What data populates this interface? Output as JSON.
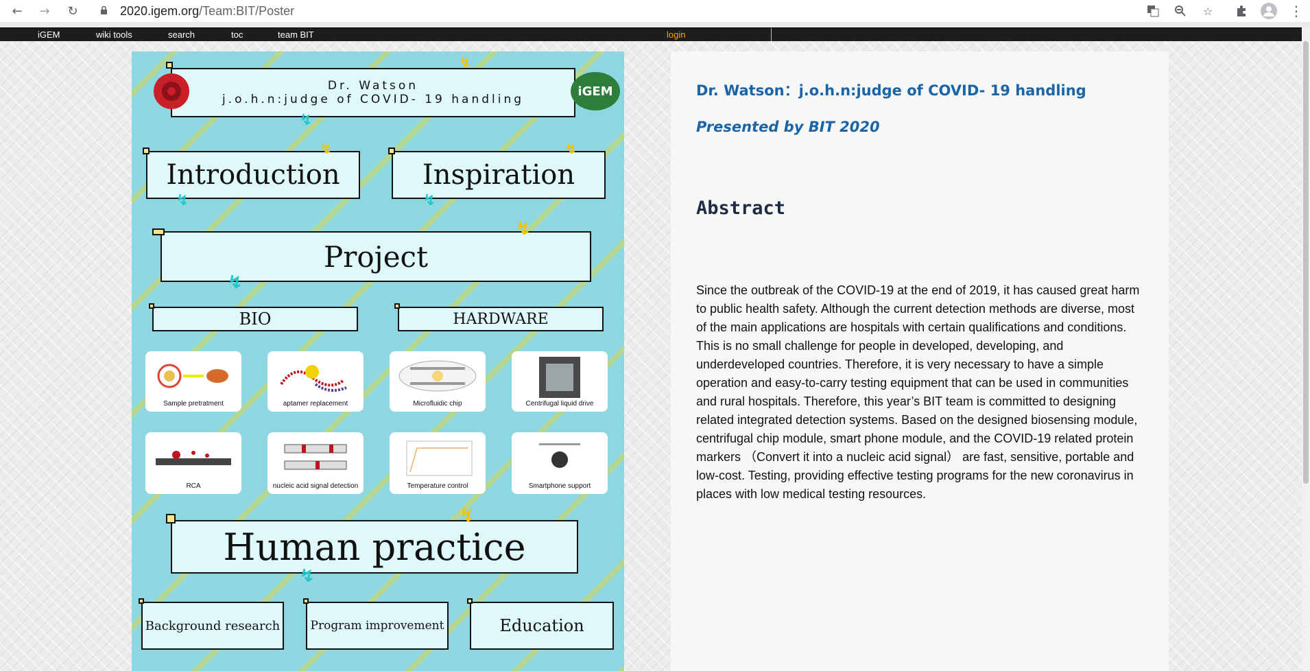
{
  "browser": {
    "url_host": "2020.igem.org",
    "url_path": "/Team:BIT/Poster",
    "icons": [
      "back-icon",
      "forward-icon",
      "reload-icon",
      "lock-icon",
      "translate-icon",
      "zoom-icon",
      "star-icon",
      "extensions-icon",
      "profile-icon",
      "menu-icon"
    ]
  },
  "menubar": {
    "items": [
      "iGEM",
      "wiki tools",
      "search",
      "toc",
      "team BIT"
    ],
    "login": "login"
  },
  "poster": {
    "title_line1": "Dr. Watson",
    "title_line2": "j.o.h.n:judge of COVID- 19 handling",
    "logo": "iGEM",
    "introduction": "Introduction",
    "inspiration": "Inspiration",
    "project": "Project",
    "bio": "BIO",
    "hardware": "HARDWARE",
    "cards": [
      "Sample pretratment",
      "aptamer replacement",
      "Microfluidic chip",
      "Centrifugal liquid drive",
      "RCA",
      "nucleic acid signal detection",
      "Temperature control",
      "Smartphone support"
    ],
    "human_practice": "Human practice",
    "background": "Background research",
    "program": "Program improvement",
    "education": "Education"
  },
  "content": {
    "title": "Dr. Watson：j.o.h.n:judge of COVID- 19 handling",
    "subtitle": "Presented by BIT 2020",
    "abstract_heading": "Abstract",
    "abstract_text": "Since the outbreak of the COVID-19 at the end of 2019, it has caused great harm to public health safety. Although the current detection methods are diverse, most of the main applications are hospitals with certain qualifications and conditions. This is no small challenge for people in developed, developing, and underdeveloped countries. Therefore, it is very necessary to have a simple operation and easy-to-carry testing equipment that can be used in communities and rural hospitals. Therefore, this year’s BIT team is committed to designing related integrated detection systems. Based on the designed biosensing module, centrifugal chip module, smart phone module, and the COVID-19 related protein markers （Convert it into a nucleic acid signal） are fast, sensitive, portable and low-cost. Testing, providing effective testing programs for the new coronavirus in places with low medical testing resources."
  }
}
